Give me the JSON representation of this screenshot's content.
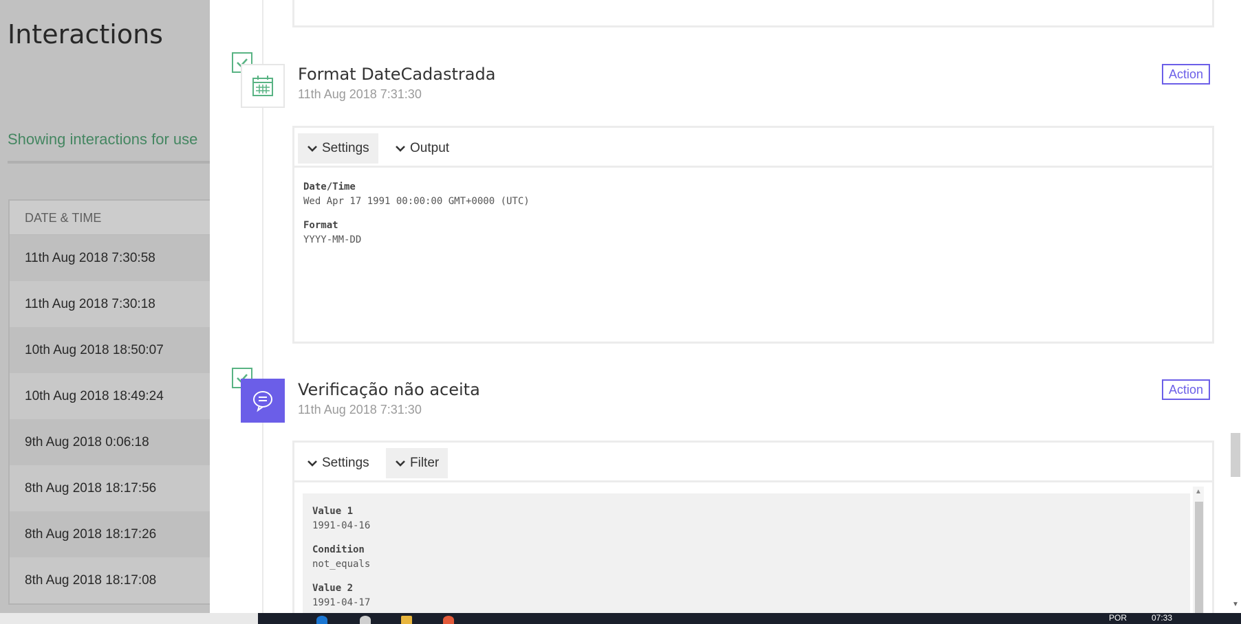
{
  "background_page": {
    "title": "Interactions",
    "subtitle": "Showing interactions for use",
    "table_header": "DATE & TIME",
    "rows": [
      "11th Aug 2018 7:30:58",
      "11th Aug 2018 7:30:18",
      "10th Aug 2018 18:50:07",
      "10th Aug 2018 18:49:24",
      "9th Aug 2018 0:06:18",
      "8th Aug 2018 18:17:56",
      "8th Aug 2018 18:17:26",
      "8th Aug 2018 18:17:08"
    ]
  },
  "steps": [
    {
      "title": "Format DateCadastrada",
      "timestamp": "11th Aug 2018 7:31:30",
      "badge": "Action",
      "icon": "calendar-icon",
      "tabs": [
        "Settings",
        "Output"
      ],
      "active_tab": "Settings",
      "fields": [
        {
          "label": "Date/Time",
          "value": "Wed Apr 17 1991 00:00:00 GMT+0000 (UTC)"
        },
        {
          "label": "Format",
          "value": "YYYY-MM-DD"
        }
      ]
    },
    {
      "title": "Verificação não aceita",
      "timestamp": "11th Aug 2018 7:31:30",
      "badge": "Action",
      "icon": "chat-bubble-icon",
      "tabs": [
        "Settings",
        "Filter"
      ],
      "active_tab": "Filter",
      "fields": [
        {
          "label": "Value 1",
          "value": "1991-04-16"
        },
        {
          "label": "Condition",
          "value": "not_equals"
        },
        {
          "label": "Value 2",
          "value": "1991-04-17"
        }
      ]
    }
  ],
  "taskbar": {
    "language": "POR",
    "time": "07:33"
  },
  "colors": {
    "accent_purple": "#6b5ee8",
    "check_green": "#58b383",
    "subtitle_green": "#56a87a"
  }
}
